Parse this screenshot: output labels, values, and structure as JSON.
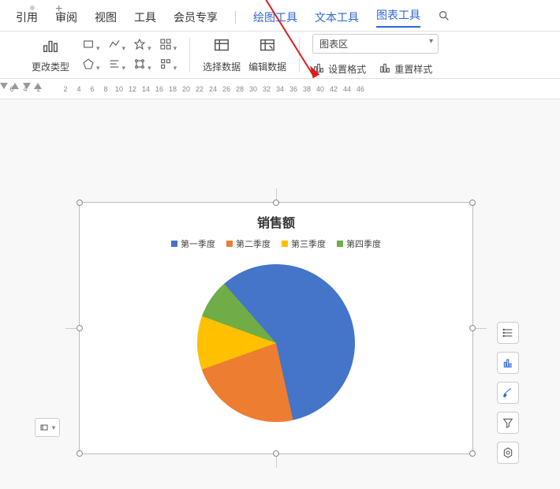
{
  "top": {
    "tabs": [
      "引用",
      "审阅",
      "视图",
      "工具",
      "会员专享"
    ],
    "context_tabs": [
      "绘图工具",
      "文本工具",
      "图表工具"
    ],
    "active_context": "图表工具"
  },
  "ribbon": {
    "change_type": "更改类型",
    "select_data": "选择数据",
    "edit_data": "编辑数据",
    "area_combo": "图表区",
    "set_format": "设置格式",
    "reset_style": "重置样式"
  },
  "ruler": {
    "left": [
      "6",
      "4",
      "2"
    ],
    "right": [
      "2",
      "4",
      "6",
      "8",
      "10",
      "12",
      "14",
      "16",
      "18",
      "20",
      "22",
      "24",
      "26",
      "28",
      "30",
      "32",
      "34",
      "36",
      "38",
      "40",
      "42",
      "44",
      "46"
    ]
  },
  "chart_data": {
    "type": "pie",
    "title": "销售额",
    "series_labels": [
      "第一季度",
      "第二季度",
      "第三季度",
      "第四季度"
    ],
    "colors": [
      "#4475c8",
      "#ed7d31",
      "#ffc000",
      "#70ad47"
    ],
    "values_pct": [
      58,
      23,
      11,
      8
    ]
  }
}
